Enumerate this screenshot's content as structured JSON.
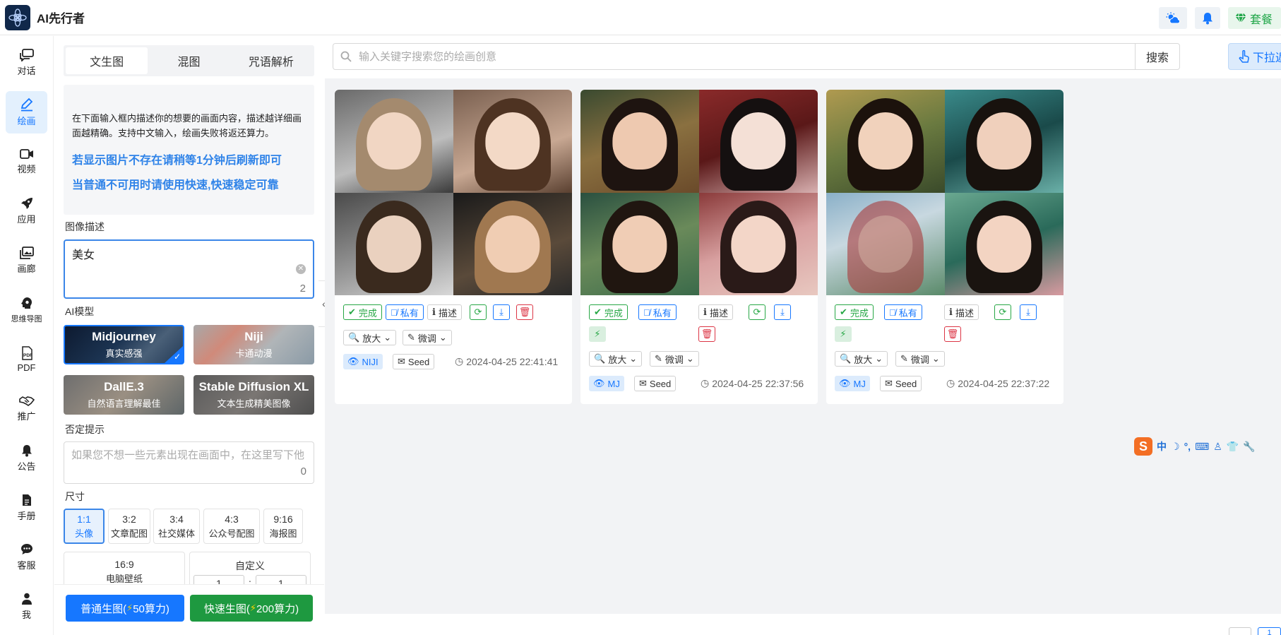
{
  "header": {
    "title": "AI先行者",
    "package_label": "套餐"
  },
  "nav": [
    {
      "label": "对话",
      "icon": "chat-icon"
    },
    {
      "label": "绘画",
      "icon": "paint-icon",
      "active": true
    },
    {
      "label": "视频",
      "icon": "video-icon"
    },
    {
      "label": "应用",
      "icon": "rocket-icon"
    },
    {
      "label": "画廊",
      "icon": "gallery-icon"
    },
    {
      "label": "思维导图",
      "icon": "mindmap-icon"
    },
    {
      "label": "PDF",
      "icon": "pdf-icon"
    },
    {
      "label": "推广",
      "icon": "handshake-icon"
    },
    {
      "label": "公告",
      "icon": "bell-icon"
    },
    {
      "label": "手册",
      "icon": "manual-icon"
    },
    {
      "label": "客服",
      "icon": "support-icon"
    },
    {
      "label": "我",
      "icon": "user-icon"
    }
  ],
  "panel": {
    "tabs": [
      "文生图",
      "混图",
      "咒语解析"
    ],
    "notice": {
      "info": "在下面输入框内描述你的想要的画面内容，描述越详细画面越精确。支持中文输入，绘画失败将返还算力。",
      "warn1": "若显示图片不存在请稍等1分钟后刷新即可",
      "warn2": "当普通不可用时请使用快速,快速稳定可靠"
    },
    "prompt_label": "图像描述",
    "prompt_value": "美女",
    "prompt_count": "2",
    "model_label": "AI模型",
    "models": [
      {
        "name": "Midjourney",
        "sub": "真实感强"
      },
      {
        "name": "Niji",
        "sub": "卡通动漫"
      },
      {
        "name": "DallE.3",
        "sub": "自然语言理解最佳"
      },
      {
        "name": "Stable Diffusion XL",
        "sub": "文本生成精美图像"
      }
    ],
    "negative_label": "否定提示",
    "negative_placeholder": "如果您不想一些元素出现在画面中，在这里写下他",
    "negative_count": "0",
    "size_label": "尺寸",
    "sizes": [
      {
        "ratio": "1:1",
        "sub": "头像"
      },
      {
        "ratio": "3:2",
        "sub": "文章配图"
      },
      {
        "ratio": "3:4",
        "sub": "社交媒体"
      },
      {
        "ratio": "4:3",
        "sub": "公众号配图"
      },
      {
        "ratio": "9:16",
        "sub": "海报图"
      },
      {
        "ratio": "16:9",
        "sub": "电脑壁纸"
      }
    ],
    "custom_label": "自定义",
    "custom_w": "1",
    "custom_h": "1",
    "custom_sep": ":",
    "gen_normal": "普通生图(",
    "gen_normal_cost": "50算力)",
    "gen_fast": "快速生图(",
    "gen_fast_cost": "200算力)"
  },
  "main": {
    "search_placeholder": "输入关键字搜索您的绘画创意",
    "search_button": "搜索",
    "pull_button": "下拉返",
    "cards": [
      {
        "done": "完成",
        "private": "私有",
        "describe": "描述",
        "upscale": "放大",
        "tune": "微调",
        "model": "NIJI",
        "seed": "Seed",
        "time": "2024-04-25 22:41:41"
      },
      {
        "done": "完成",
        "private": "私有",
        "describe": "描述",
        "upscale": "放大",
        "tune": "微调",
        "model": "MJ",
        "seed": "Seed",
        "time": "2024-04-25 22:37:56"
      },
      {
        "done": "完成",
        "private": "私有",
        "describe": "描述",
        "upscale": "放大",
        "tune": "微调",
        "model": "MJ",
        "seed": "Seed",
        "time": "2024-04-25 22:37:22"
      }
    ],
    "page": "1"
  },
  "ime": {
    "items": [
      "中",
      "☽",
      "°,",
      "⌨",
      "♙",
      "👕",
      "🔧"
    ],
    "logo": "S"
  }
}
